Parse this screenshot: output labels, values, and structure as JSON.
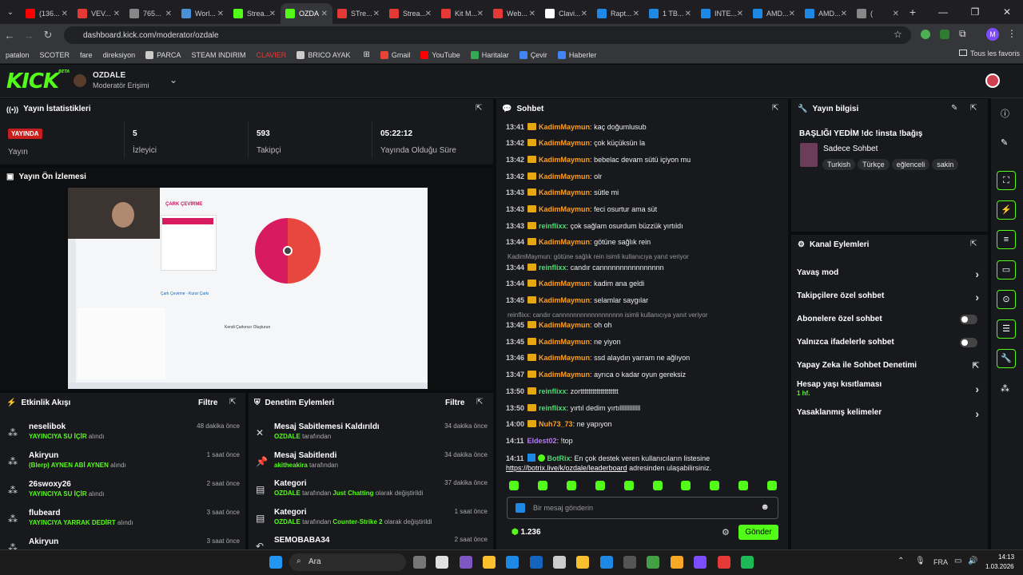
{
  "browser": {
    "tabs": [
      {
        "title": "(136...",
        "color": "#ff0000"
      },
      {
        "title": "VEV...",
        "color": "#e53935"
      },
      {
        "title": "765...",
        "color": "#888888"
      },
      {
        "title": "Worl...",
        "color": "#4a90d9"
      },
      {
        "title": "Strea...",
        "color": "#53fc18"
      },
      {
        "title": "OZDA",
        "color": "#53fc18",
        "active": true
      },
      {
        "title": "STre...",
        "color": "#e53935"
      },
      {
        "title": "Strea...",
        "color": "#e53935"
      },
      {
        "title": "Kit M...",
        "color": "#e53935"
      },
      {
        "title": "Web...",
        "color": "#e53935"
      },
      {
        "title": "Clavi...",
        "color": "#ffffff"
      },
      {
        "title": "Rapt...",
        "color": "#1e88e5"
      },
      {
        "title": "1 TB...",
        "color": "#1e88e5"
      },
      {
        "title": "INTE...",
        "color": "#1e88e5"
      },
      {
        "title": "AMD...",
        "color": "#1e88e5"
      },
      {
        "title": "AMD...",
        "color": "#1e88e5"
      },
      {
        "title": "(",
        "color": "#888888"
      }
    ],
    "url": "dashboard.kick.com/moderator/ozdale",
    "bookmarks": [
      "patalon",
      "SCOTER",
      "fare",
      "direksiyon",
      "PARCA",
      "STEAM INDIRIM",
      "CLAVIER",
      "BRICO AYAK",
      "Gmail",
      "YouTube",
      "Haritalar",
      "Çevir",
      "Haberler"
    ],
    "bookmarks_right": "Tous les favoris"
  },
  "header": {
    "logo": "KICK",
    "logo_sup": "BETA",
    "channel": "OZDALE",
    "role": "Moderatör Erişimi"
  },
  "stats": {
    "title": "Yayın İstatistikleri",
    "live_badge": "YAYINDA",
    "live_label": "Yayın",
    "viewers": "5",
    "viewers_label": "İzleyici",
    "followers": "593",
    "followers_label": "Takipçi",
    "uptime": "05:22:12",
    "uptime_label": "Yayında Olduğu Süre"
  },
  "preview": {
    "title": "Yayın Ön İzlemesi",
    "screen_title": "ÇARK ÇEVİRME",
    "screen_sub": "Çark Çevirme - Kurar Çarkı",
    "screen_center": "Kendi Çarkınızı Oluşturun"
  },
  "activity": {
    "title": "Etkinlik Akışı",
    "filter": "Filtre",
    "items": [
      {
        "name": "neselibok",
        "desc_hl": "YAYINCIYA SU İÇİR",
        "desc": "alındı",
        "time": "48 dakika önce"
      },
      {
        "name": "Akiryun",
        "desc_hl": "(Blerp) AYNEN ABİ AYNEN",
        "desc": "alındı",
        "time": "1 saat önce"
      },
      {
        "name": "26swoxy26",
        "desc_hl": "YAYINCIYA SU İÇİR",
        "desc": "alındı",
        "time": "2 saat önce"
      },
      {
        "name": "flubeard",
        "desc_hl": "YAYINCIYA YARRAK DEDİRT",
        "desc": "alındı",
        "time": "3 saat önce"
      },
      {
        "name": "Akiryun",
        "desc_hl": "",
        "desc": "",
        "time": "3 saat önce"
      }
    ]
  },
  "moderation": {
    "title": "Denetim Eylemleri",
    "filter": "Filtre",
    "items": [
      {
        "name": "Mesaj Sabitlemesi Kaldırıldı",
        "hl": "OZDALE",
        "desc": "tarafından",
        "time": "34 dakika önce"
      },
      {
        "name": "Mesaj Sabitlendi",
        "hl": "akitheakira",
        "desc": "tarafından",
        "time": "34 dakika önce"
      },
      {
        "name": "Kategori",
        "hl": "OZDALE",
        "desc": "tarafından",
        "hl2": "Just Chatting",
        "desc2": "olarak değiştirildi",
        "time": "37 dakika önce"
      },
      {
        "name": "Kategori",
        "hl": "OZDALE",
        "desc": "tarafından",
        "hl2": "Counter-Strike 2",
        "desc2": "olarak değiştirildi",
        "time": "1 saat önce"
      },
      {
        "name": "SEMOBABA34",
        "hl": "",
        "desc": "",
        "time": "2 saat önce"
      }
    ]
  },
  "chat": {
    "title": "Sohbet",
    "messages": [
      {
        "time": "13:41",
        "user": "KadimMaymun",
        "c": "or",
        "text": "kaç doğumlusub"
      },
      {
        "time": "13:42",
        "user": "KadimMaymun",
        "c": "or",
        "text": "çok küçüksün la"
      },
      {
        "time": "13:42",
        "user": "KadimMaymun",
        "c": "or",
        "text": "bebelac devam sütü içiyon mu"
      },
      {
        "time": "13:42",
        "user": "KadimMaymun",
        "c": "or",
        "text": "olr"
      },
      {
        "time": "13:43",
        "user": "KadimMaymun",
        "c": "or",
        "text": "sütle mi"
      },
      {
        "time": "13:43",
        "user": "KadimMaymun",
        "c": "or",
        "text": "feci osurtur ama süt"
      },
      {
        "time": "13:43",
        "user": "reinflixx",
        "c": "gr",
        "text": "çok sağlam osurdum büzzük yırtıldı"
      },
      {
        "time": "13:44",
        "user": "KadimMaymun",
        "c": "or",
        "text": "götüne sağlık rein"
      },
      {
        "reply": "KadimMaymun: götüne sağlık rein isimli kullanıcıya yanıt veriyor"
      },
      {
        "time": "13:44",
        "user": "reinflixx",
        "c": "gr",
        "text": "candır cannnnnnnnnnnnnnnn"
      },
      {
        "time": "13:44",
        "user": "KadimMaymun",
        "c": "or",
        "text": "kadim ana geldi"
      },
      {
        "time": "13:45",
        "user": "KadimMaymun",
        "c": "or",
        "text": "selamlar saygılar"
      },
      {
        "reply": "reinflixx: candır cannnnnnnnnnnnnnnnnn isimli kullanıcıya yanıt veriyor"
      },
      {
        "time": "13:45",
        "user": "KadimMaymun",
        "c": "or",
        "text": "oh oh"
      },
      {
        "time": "13:45",
        "user": "KadimMaymun",
        "c": "or",
        "text": "ne yiyon"
      },
      {
        "time": "13:46",
        "user": "KadimMaymun",
        "c": "or",
        "text": "ssd alaydın yarram ne ağlıyon"
      },
      {
        "time": "13:47",
        "user": "KadimMaymun",
        "c": "or",
        "text": "ayrıca o kadar oyun gereksiz"
      },
      {
        "time": "13:50",
        "user": "reinflixx",
        "c": "gr",
        "text": "zorttttttttttttttttttt"
      },
      {
        "time": "13:50",
        "user": "reinflixx",
        "c": "gr",
        "text": "yırtıl dedim yırtılllllllllllll"
      },
      {
        "time": "14:00",
        "user": "Nuh73_73",
        "c": "or",
        "text": "ne yapıyon"
      },
      {
        "time": "14:11",
        "user": "Eldest02",
        "c": "pu",
        "text": "!top",
        "nocrown": true
      },
      {
        "time": "14:11",
        "user": "BotRix",
        "c": "gr",
        "text": "En çok destek veren kullanıcıların listesine",
        "nocrown": true
      },
      {
        "cont": "https://botrix.live/k/ozdale/leaderboard",
        "cont2": "adresinden ulaşabilirsiniz."
      }
    ],
    "placeholder": "Bir mesaj gönderin",
    "points": "1.236",
    "send": "Gönder"
  },
  "info": {
    "title": "Yayın bilgisi",
    "stream_title": "BAŞLIĞI YEDİM !dc !insta !bağış",
    "category": "Sadece Sohbet",
    "tags": [
      "Turkish",
      "Türkçe",
      "eğlenceli",
      "sakin"
    ]
  },
  "kanal": {
    "title": "Kanal Eylemleri",
    "rows": [
      {
        "label": "Yavaş mod",
        "type": "arrow"
      },
      {
        "label": "Takipçilere özel sohbet",
        "type": "arrow"
      },
      {
        "label": "Abonelere özel sohbet",
        "type": "toggle"
      },
      {
        "label": "Yalnızca ifadelerle sohbet",
        "type": "toggle"
      },
      {
        "label": "Yapay Zeka ile Sohbet Denetimi",
        "type": "link"
      },
      {
        "label": "Hesap yaşı kısıtlaması",
        "sub": "1 hf.",
        "type": "arrow"
      },
      {
        "label": "Yasaklanmış kelimeler",
        "type": "arrow"
      }
    ]
  },
  "taskbar": {
    "search": "Ara",
    "lang": "FRA",
    "time": "14:13",
    "date": "1.03.2026"
  },
  "colors": {
    "accent": "#53fc18",
    "live": "#c81e1e"
  }
}
